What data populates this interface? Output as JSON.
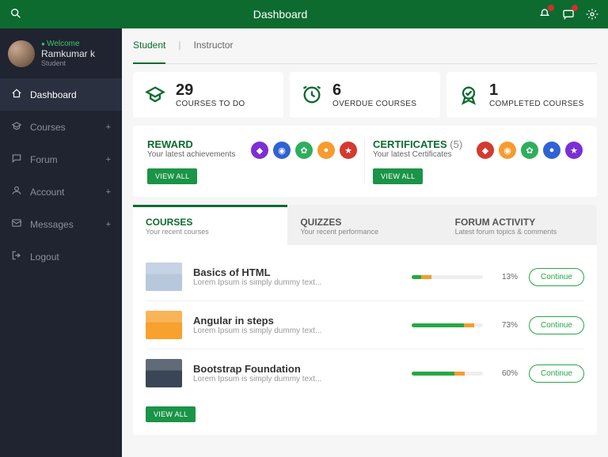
{
  "topbar": {
    "title": "Dashboard"
  },
  "profile": {
    "welcome": "Welcome",
    "name": "Ramkumar k",
    "role": "Student"
  },
  "nav": {
    "items": [
      {
        "label": "Dashboard",
        "active": true,
        "expand": false
      },
      {
        "label": "Courses",
        "active": false,
        "expand": true
      },
      {
        "label": "Forum",
        "active": false,
        "expand": true
      },
      {
        "label": "Account",
        "active": false,
        "expand": true
      },
      {
        "label": "Messages",
        "active": false,
        "expand": true
      },
      {
        "label": "Logout",
        "active": false,
        "expand": false
      }
    ]
  },
  "roletabs": {
    "student": "Student",
    "instructor": "Instructor"
  },
  "stats": [
    {
      "num": "29",
      "label": "COURSES TO DO"
    },
    {
      "num": "6",
      "label": "OVERDUE COURSES"
    },
    {
      "num": "1",
      "label": "COMPLETED COURSES"
    }
  ],
  "reward": {
    "title": "REWARD",
    "sub": "Your latest achievements",
    "colors": [
      "#7b2fd4",
      "#2f62d4",
      "#2fae5b",
      "#f79b2e",
      "#d43a2f"
    ]
  },
  "certs": {
    "title": "CERTIFICATES",
    "count": "(5)",
    "sub": "Your latest Certificates",
    "colors": [
      "#d43a2f",
      "#f79b2e",
      "#2fae5b",
      "#2f62d4",
      "#7b2fd4"
    ]
  },
  "viewall": "VIEW ALL",
  "tabs": [
    {
      "title": "COURSES",
      "sub": "Your recent courses",
      "active": true
    },
    {
      "title": "QUIZZES",
      "sub": "Your recent performance",
      "active": false
    },
    {
      "title": "FORUM ACTIVITY",
      "sub": "Latest forum topics & comments",
      "active": false
    }
  ],
  "courses": [
    {
      "title": "Basics of HTML",
      "desc": "Lorem Ipsum is simply dummy text...",
      "pct": "13%",
      "p": 13,
      "thumb": "#b7c8dd"
    },
    {
      "title": "Angular in steps",
      "desc": "Lorem Ipsum is simply dummy text...",
      "pct": "73%",
      "p": 73,
      "thumb": "#f7a22e"
    },
    {
      "title": "Bootstrap Foundation",
      "desc": "Lorem Ipsum is simply dummy text...",
      "pct": "60%",
      "p": 60,
      "thumb": "#3a4656"
    }
  ],
  "continue": "Continue"
}
